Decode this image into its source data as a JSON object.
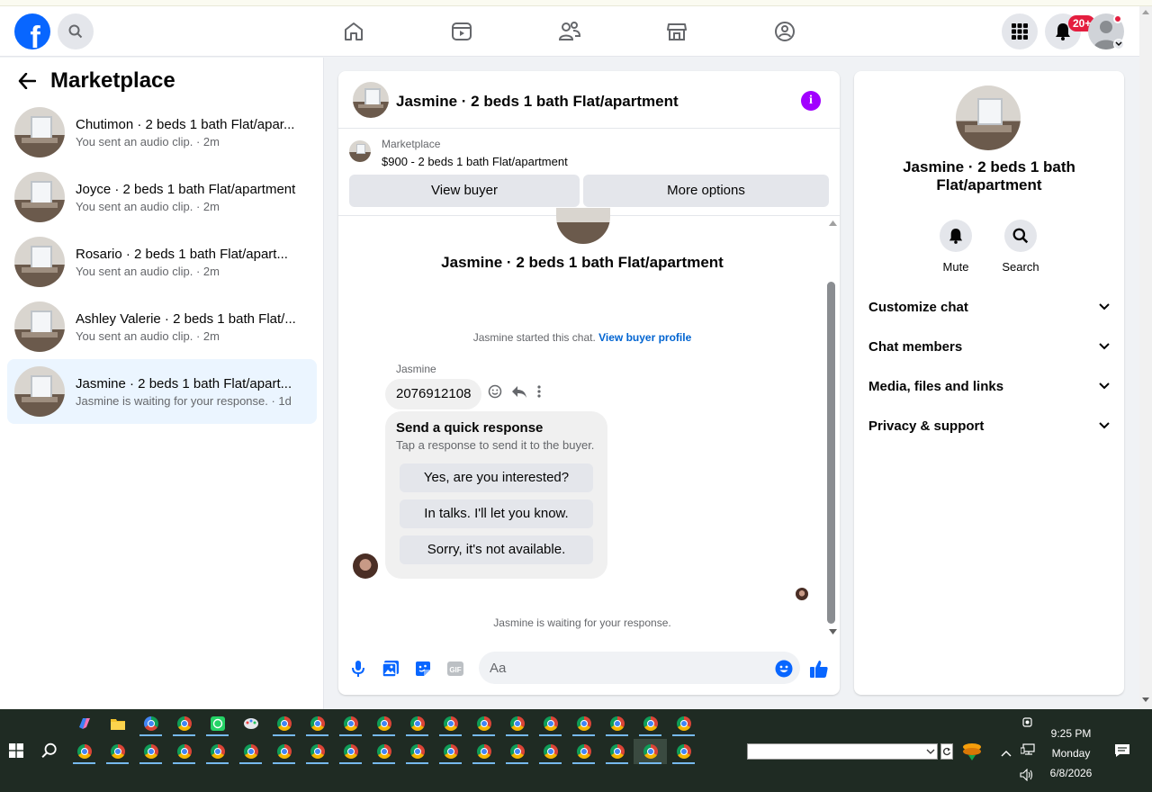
{
  "topbar": {
    "logo_letter": "f",
    "notification_count": "20+"
  },
  "left": {
    "title": "Marketplace",
    "conversations": [
      {
        "name": "Chutimon · 2 beds 1 bath Flat/apar...",
        "sub": "You sent an audio clip. · 2m"
      },
      {
        "name": "Joyce · 2 beds 1 bath Flat/apartment",
        "sub": "You sent an audio clip. · 2m"
      },
      {
        "name": "Rosario · 2 beds 1 bath Flat/apart...",
        "sub": "You sent an audio clip. · 2m"
      },
      {
        "name": "Ashley Valerie · 2 beds 1 bath Flat/...",
        "sub": "You sent an audio clip. · 2m"
      },
      {
        "name": "Jasmine · 2 beds 1 bath Flat/apart...",
        "sub": "Jasmine is waiting for your response. · 1d"
      }
    ]
  },
  "chat": {
    "title": "Jasmine · 2 beds 1 bath Flat/apartment",
    "marketplace_label": "Marketplace",
    "listing": "$900 - 2 beds 1 bath Flat/apartment",
    "view_buyer": "View buyer",
    "more_options": "More options",
    "header_name": "Jasmine · 2 beds 1 bath Flat/apartment",
    "started_text": "Jasmine started this chat.",
    "view_buyer_profile": "View buyer profile",
    "sender": "Jasmine",
    "message": "2076912108",
    "quick_title": "Send a quick response",
    "quick_sub": "Tap a response to send it to the buyer.",
    "quick_replies": [
      "Yes, are you interested?",
      "In talks. I'll let you know.",
      "Sorry, it's not available."
    ],
    "waiting": "Jasmine is waiting for your response.",
    "input_placeholder": "Aa"
  },
  "right": {
    "title": "Jasmine · 2 beds 1 bath Flat/apartment",
    "mute": "Mute",
    "search": "Search",
    "sections": [
      "Customize chat",
      "Chat members",
      "Media, files and links",
      "Privacy & support"
    ]
  },
  "taskbar": {
    "time": "9:25 PM",
    "day": "Monday",
    "date": "6/8/2026"
  },
  "colors": {
    "brand": "#0866ff",
    "info": "#a100ff",
    "active_conv": "#ebf5ff",
    "link": "#0064d1"
  }
}
